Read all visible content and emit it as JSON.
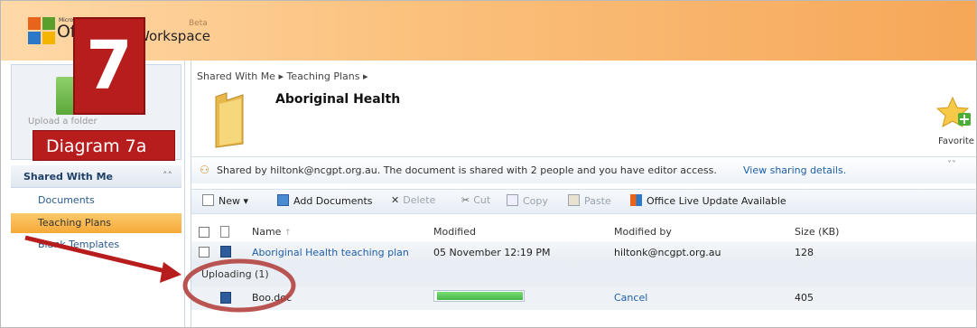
{
  "header": {
    "brand_small": "Microsoft",
    "brand": "Office",
    "brand2": "Workspace",
    "beta": "Beta"
  },
  "sidebar": {
    "upload_label": "Upload a folder",
    "section_title": "Shared With Me",
    "items": [
      {
        "label": "Documents",
        "active": false
      },
      {
        "label": "Teaching Plans",
        "active": true
      },
      {
        "label": "Blank Templates",
        "active": false
      }
    ]
  },
  "breadcrumb": {
    "path": "Shared With Me ▸ Teaching Plans ▸"
  },
  "folder": {
    "title": "Aboriginal Health",
    "favorite_label": "Favorite"
  },
  "share": {
    "text": "Shared by hiltonk@ncgpt.org.au. The document is shared with 2 people and you have editor access.",
    "link": "View sharing details."
  },
  "toolbar": {
    "new": "New",
    "add_documents": "Add Documents",
    "delete": "Delete",
    "cut": "Cut",
    "copy": "Copy",
    "paste": "Paste",
    "update": "Office Live Update Available"
  },
  "table": {
    "columns": {
      "name": "Name",
      "modified": "Modified",
      "modified_by": "Modified by",
      "size": "Size (KB)"
    },
    "rows": [
      {
        "name": "Aboriginal Health teaching plan",
        "modified": "05 November 12:19 PM",
        "modified_by": "hiltonk@ncgpt.org.au",
        "size": "128"
      }
    ],
    "group_label": "Uploading (1)",
    "uploading": {
      "name": "Boo.doc",
      "progress": 1.0,
      "action": "Cancel",
      "size": "405"
    }
  },
  "annotations": {
    "step_number": "7",
    "diagram_label": "Diagram 7a",
    "accent_color": "#b81d1d"
  }
}
